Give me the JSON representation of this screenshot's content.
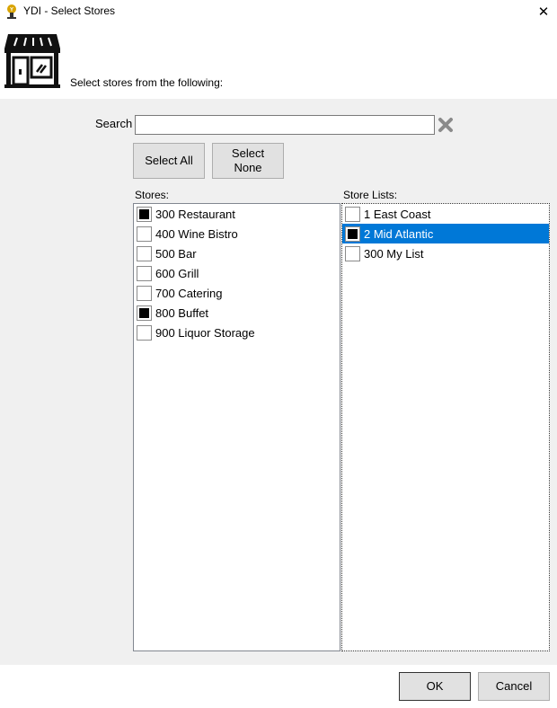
{
  "window": {
    "title": "YDI - Select Stores",
    "close_label": "✕"
  },
  "header": {
    "instruction": "Select stores from the following:"
  },
  "search": {
    "label": "Search",
    "value": "",
    "placeholder": ""
  },
  "buttons": {
    "select_all": "Select All",
    "select_none": "Select None",
    "ok": "OK",
    "cancel": "Cancel"
  },
  "stores": {
    "label": "Stores:",
    "items": [
      {
        "label": "300 Restaurant",
        "checked": true
      },
      {
        "label": "400 Wine Bistro",
        "checked": false
      },
      {
        "label": "500 Bar",
        "checked": false
      },
      {
        "label": "600 Grill",
        "checked": false
      },
      {
        "label": "700 Catering",
        "checked": false
      },
      {
        "label": "800 Buffet",
        "checked": true
      },
      {
        "label": "900 Liquor Storage",
        "checked": false
      }
    ]
  },
  "store_lists": {
    "label": "Store Lists:",
    "items": [
      {
        "label": "1 East Coast",
        "checked": false,
        "selected": false
      },
      {
        "label": "2 Mid Atlantic",
        "checked": true,
        "selected": true
      },
      {
        "label": "300 My List",
        "checked": false,
        "selected": false
      }
    ]
  },
  "icons": {
    "app": "ydi-app-icon",
    "store": "storefront-icon",
    "clear": "clear-x-icon",
    "close": "close-icon"
  },
  "colors": {
    "selection": "#0078d7",
    "panel_bg": "#f0f0f0",
    "clear_icon": "#8a8a8a"
  }
}
